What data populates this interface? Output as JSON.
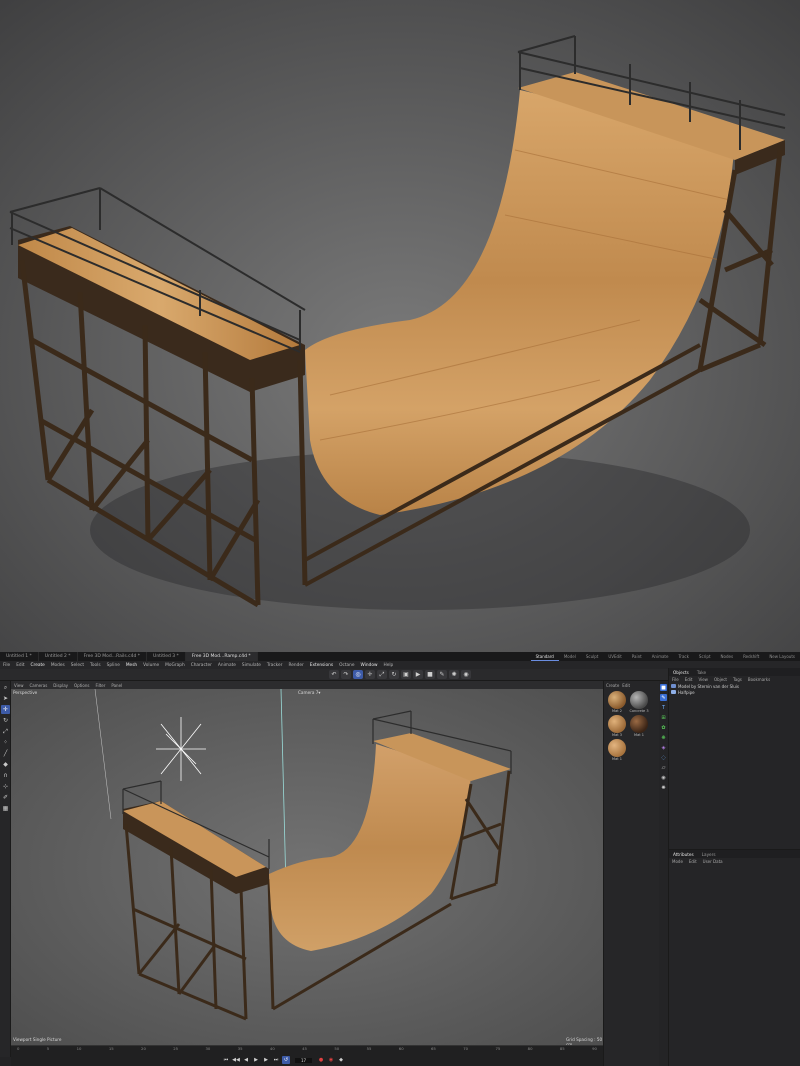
{
  "tabs": {
    "documents": [
      "Untitled 1 *",
      "Untitled 2 *",
      "Free 3D Mod...Rails.c4d *",
      "Untitled 3 *",
      "Free 3D Mod...Ramp.c4d *"
    ],
    "layouts": [
      "Standard",
      "Model",
      "Sculpt",
      "UVEdit",
      "Paint",
      "Animate",
      "Track",
      "Script",
      "Nodes",
      "Redshift",
      "New Layouts"
    ]
  },
  "menu": {
    "items": [
      "File",
      "Edit",
      "Create",
      "Modes",
      "Select",
      "Tools",
      "Spline",
      "Mesh",
      "Volume",
      "MoGraph",
      "Character",
      "Animate",
      "Simulate",
      "Tracker",
      "Render",
      "Extensions",
      "Octane",
      "Window",
      "Help"
    ],
    "highlight": [
      "Create",
      "Mesh",
      "Extensions",
      "Window"
    ]
  },
  "viewport": {
    "menu": [
      "View",
      "Cameras",
      "Display",
      "Options",
      "Filter",
      "Panel"
    ],
    "camera_label": "Perspective",
    "camera_name": "Camera 7▾",
    "grid_spacing": "Grid Spacing : 50 cm",
    "status": "Viewport Single Picture"
  },
  "timeline": {
    "ticks": [
      "0",
      "5",
      "10",
      "15",
      "20",
      "25",
      "30",
      "35",
      "40",
      "45",
      "50",
      "55",
      "60",
      "65",
      "70",
      "75",
      "80",
      "85",
      "90"
    ],
    "current_frame": "17"
  },
  "materials": {
    "menu": [
      "Create",
      "Edit"
    ],
    "items": [
      {
        "name": "Mat 2",
        "color": "#8a5a2c"
      },
      {
        "name": "Concrete 3",
        "color": "#6a6a6a"
      },
      {
        "name": "Mat 3",
        "color": "#9c6a38"
      },
      {
        "name": "Mat 1",
        "color": "#5a3a22"
      },
      {
        "name": "Mat 1",
        "color": "#a8743e"
      }
    ]
  },
  "object_panel": {
    "tabs": [
      "Objects",
      "Take"
    ],
    "menu": [
      "File",
      "Edit",
      "View",
      "Object",
      "Tags",
      "Bookmarks"
    ],
    "objects": [
      "Model by Sternin van der Sluis",
      "Halfpipe"
    ]
  },
  "attribute_panel": {
    "tabs": [
      "Attributes",
      "Layers"
    ],
    "menu": [
      "Mode",
      "Edit",
      "User Data"
    ]
  },
  "colors": {
    "accent": "#3d5ba8",
    "wood": "#c8955a",
    "frame": "#3a2a1c"
  }
}
